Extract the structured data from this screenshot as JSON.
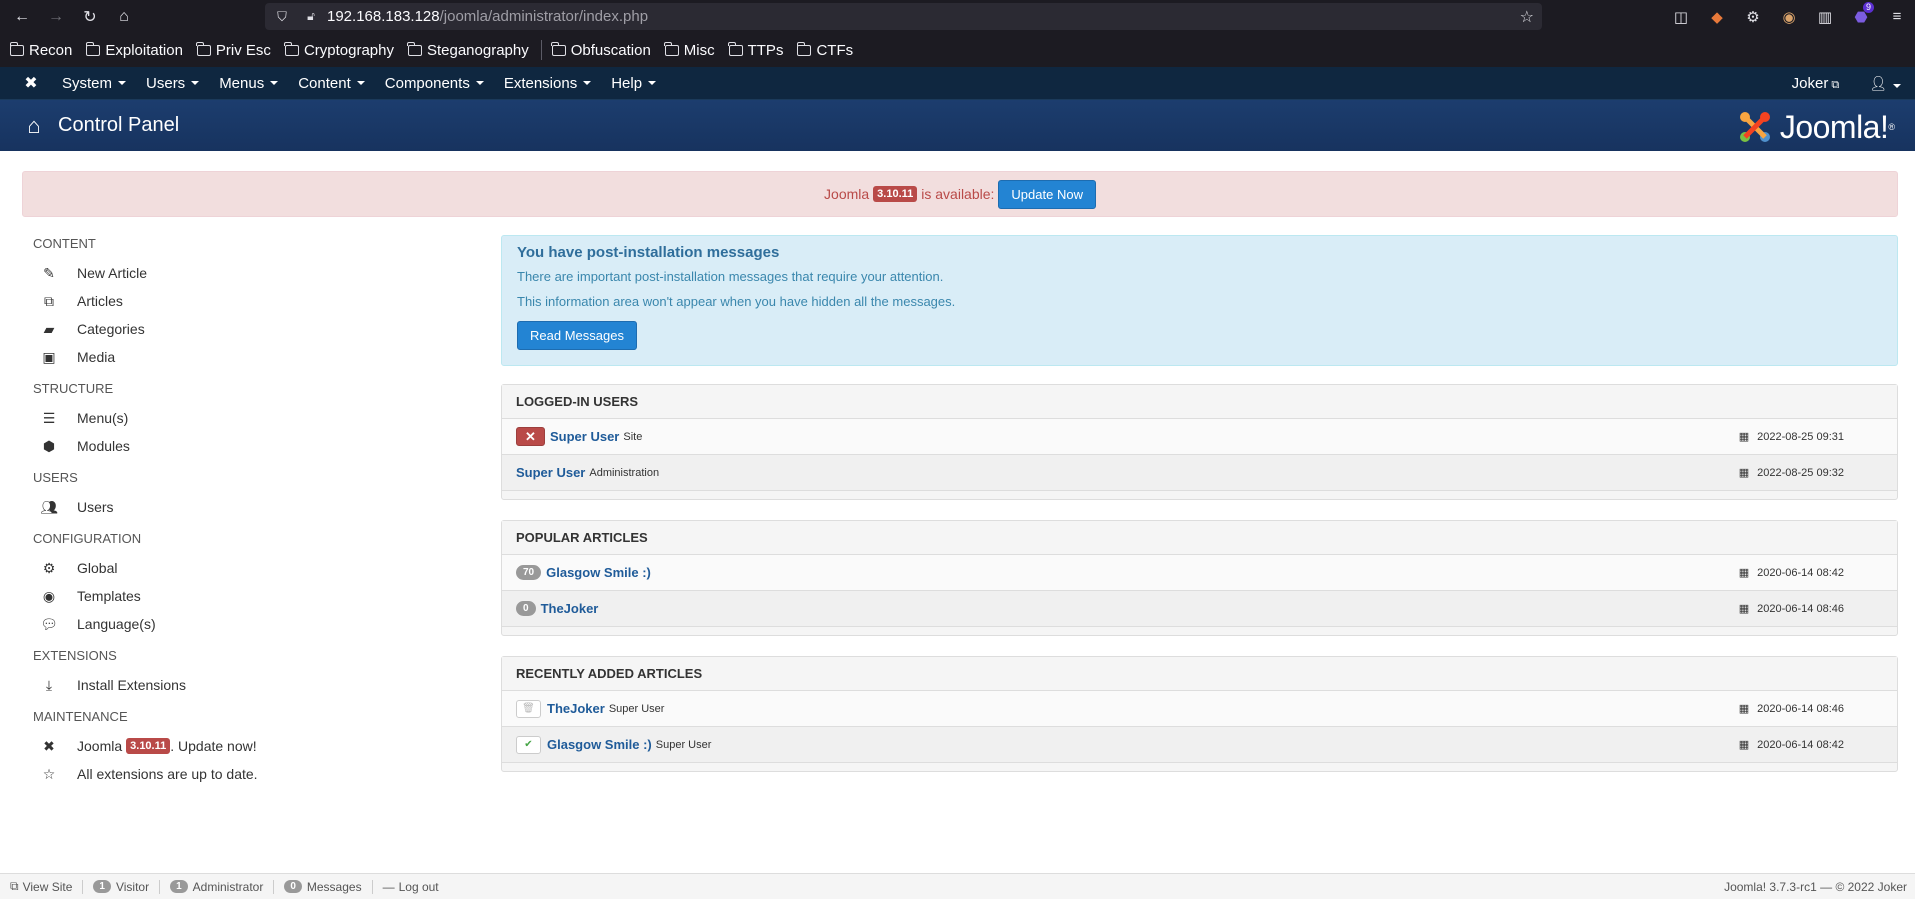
{
  "browser": {
    "url_host": "192.168.183.128",
    "url_path": "/joomla/administrator/index.php",
    "bookmarks": [
      "Recon",
      "Exploitation",
      "Priv Esc",
      "Cryptography",
      "Steganography",
      "Obfuscation",
      "Misc",
      "TTPs",
      "CTFs"
    ],
    "extension_badge": "9"
  },
  "nav": {
    "items": [
      "System",
      "Users",
      "Menus",
      "Content",
      "Components",
      "Extensions",
      "Help"
    ],
    "user": "Joker"
  },
  "header": {
    "title": "Control Panel",
    "logo_text": "Joomla!"
  },
  "update_alert": {
    "prefix": "Joomla",
    "version": "3.10.11",
    "suffix": "is available:",
    "button": "Update Now"
  },
  "sidebar": {
    "content_heading": "CONTENT",
    "content_items": [
      "New Article",
      "Articles",
      "Categories",
      "Media"
    ],
    "structure_heading": "STRUCTURE",
    "structure_items": [
      "Menu(s)",
      "Modules"
    ],
    "users_heading": "USERS",
    "users_items": [
      "Users"
    ],
    "config_heading": "CONFIGURATION",
    "config_items": [
      "Global",
      "Templates",
      "Language(s)"
    ],
    "ext_heading": "EXTENSIONS",
    "ext_items": [
      "Install Extensions"
    ],
    "maint_heading": "MAINTENANCE",
    "maint_joomla_prefix": "Joomla",
    "maint_joomla_version": "3.10.11",
    "maint_joomla_suffix": ". Update now!",
    "maint_extensions": "All extensions are up to date."
  },
  "postinstall": {
    "title": "You have post-installation messages",
    "line1": "There are important post-installation messages that require your attention.",
    "line2": "This information area won't appear when you have hidden all the messages.",
    "button": "Read Messages"
  },
  "logged_in": {
    "heading": "LOGGED-IN USERS",
    "rows": [
      {
        "name": "Super User",
        "meta": "Site",
        "date": "2022-08-25 09:31"
      },
      {
        "name": "Super User",
        "meta": "Administration",
        "date": "2022-08-25 09:32"
      }
    ]
  },
  "popular": {
    "heading": "POPULAR ARTICLES",
    "rows": [
      {
        "hits": "70",
        "title": "Glasgow Smile :)",
        "date": "2020-06-14 08:42"
      },
      {
        "hits": "0",
        "title": "TheJoker",
        "date": "2020-06-14 08:46"
      }
    ]
  },
  "recent": {
    "heading": "RECENTLY ADDED ARTICLES",
    "rows": [
      {
        "title": "TheJoker",
        "author": "Super User",
        "date": "2020-06-14 08:46"
      },
      {
        "title": "Glasgow Smile :)",
        "author": "Super User",
        "date": "2020-06-14 08:42"
      }
    ]
  },
  "status_bar": {
    "view_site": "View Site",
    "visitor_count": "1",
    "visitor_label": "Visitor",
    "admin_count": "1",
    "admin_label": "Administrator",
    "messages_count": "0",
    "messages_label": "Messages",
    "logout": "Log out",
    "right": "Joomla! 3.7.3-rc1 — © 2022 Joker"
  },
  "colors": {
    "nav_bg": "#0f2740",
    "header_bg": "#1c3d6e",
    "primary_button": "#2384d3",
    "danger": "#b94a48"
  }
}
